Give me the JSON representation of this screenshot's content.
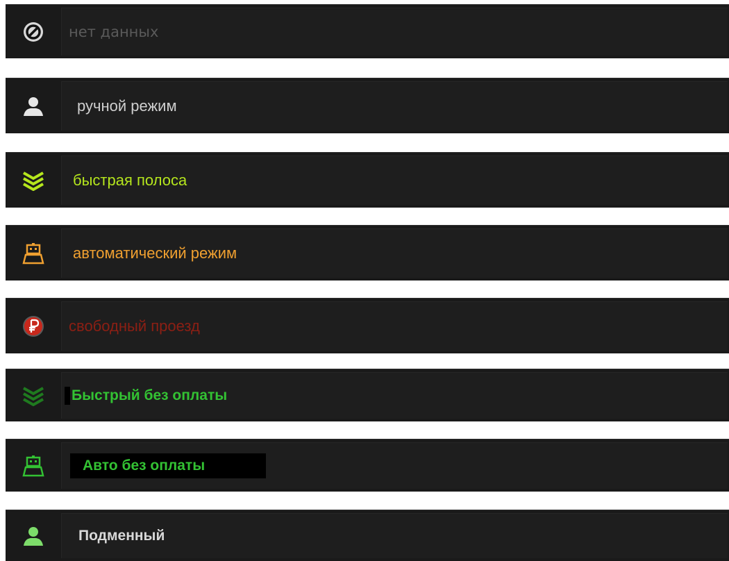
{
  "modes": [
    {
      "label": "нет данных",
      "icon": "no-data-icon",
      "color": "#5a5a5a"
    },
    {
      "label": "ручной режим",
      "icon": "person-icon",
      "color": "#cfcfcf"
    },
    {
      "label": "быстрая полоса",
      "icon": "chevrons-icon",
      "color": "#b5e61d"
    },
    {
      "label": "автоматический режим",
      "icon": "robot-icon",
      "color": "#f0a030"
    },
    {
      "label": "свободный проезд",
      "icon": "ruble-icon",
      "color": "#8c1f14"
    },
    {
      "label": "Быстрый без оплаты",
      "icon": "chevrons-icon",
      "color": "#33c233"
    },
    {
      "label": "Авто без оплаты",
      "icon": "robot-icon",
      "color": "#33c233"
    },
    {
      "label": "Подменный",
      "icon": "person-icon",
      "color": "#d8d8d8"
    }
  ]
}
